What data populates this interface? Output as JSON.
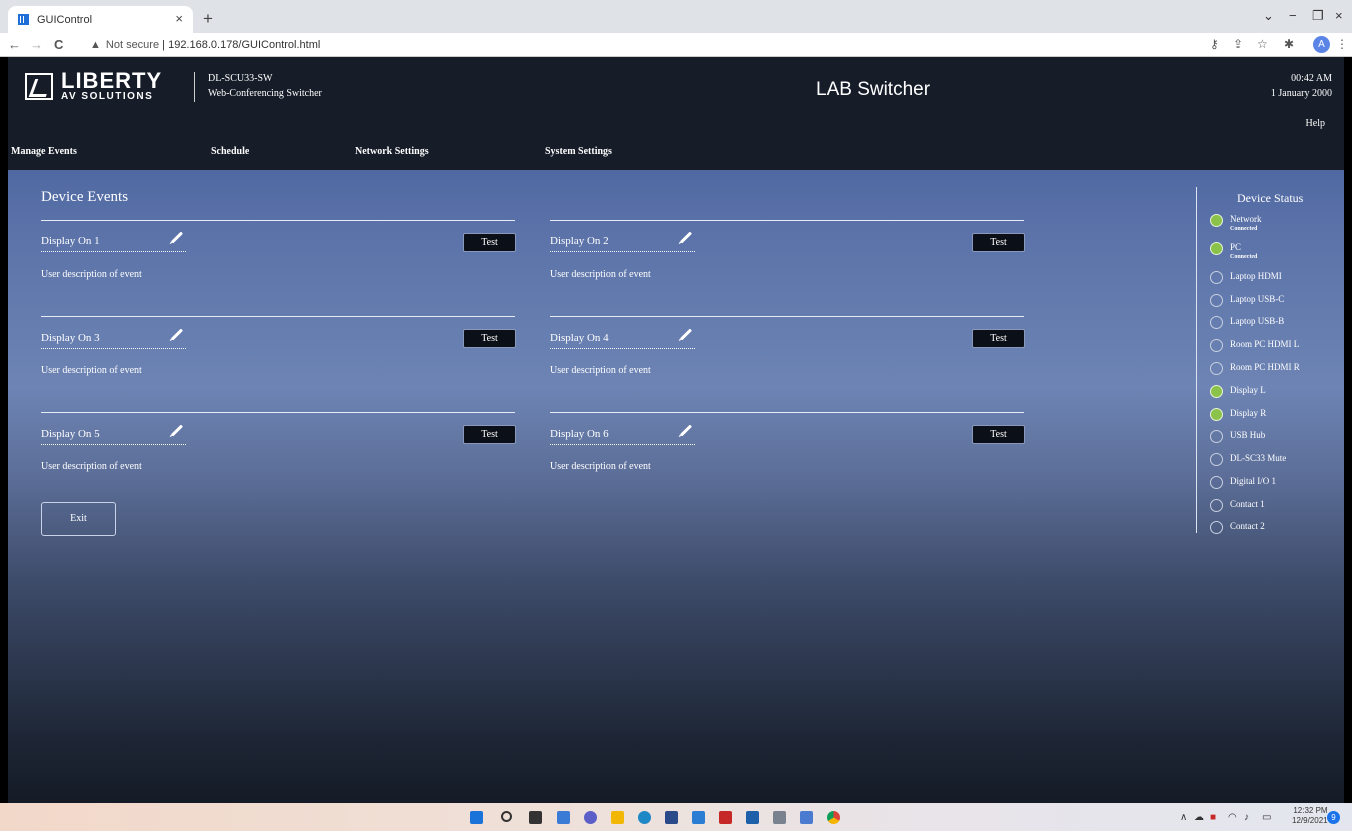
{
  "browser": {
    "tab_title": "GUIControl",
    "tab_close": "×",
    "new_tab": "+",
    "not_secure": "Not secure",
    "url": "192.168.0.178/GUIControl.html",
    "back": "←",
    "forward": "→",
    "reload": "C",
    "minimize": "−",
    "maximize": "❐",
    "close": "×",
    "dropdown": "⌄",
    "profile_initial": "A"
  },
  "header": {
    "logo_main": "LIBERTY",
    "logo_sub": "AV SOLUTIONS",
    "model": "DL-SCU33-SW",
    "model_desc": "Web-Conferencing Switcher",
    "app_title": "LAB Switcher",
    "time": "00:42 AM",
    "date": "1 January 2000",
    "help": "Help"
  },
  "menu": [
    "Manage Events",
    "Schedule",
    "Network Settings",
    "System Settings"
  ],
  "main": {
    "section_title": "Device Events",
    "test_label": "Test",
    "exit_label": "Exit",
    "events": [
      {
        "name": "Display On 1",
        "desc": "User description of event"
      },
      {
        "name": "Display On 2",
        "desc": "User description of event"
      },
      {
        "name": "Display On 3",
        "desc": "User description of event"
      },
      {
        "name": "Display On 4",
        "desc": "User description of event"
      },
      {
        "name": "Display On 5",
        "desc": "User description of event"
      },
      {
        "name": "Display On 6",
        "desc": "User description of event"
      }
    ]
  },
  "status": {
    "title": "Device Status",
    "items": [
      {
        "label": "Network",
        "sub": "Connected",
        "on": true
      },
      {
        "label": "PC",
        "sub": "Connected",
        "on": true
      },
      {
        "label": "Laptop HDMI",
        "sub": "",
        "on": false
      },
      {
        "label": "Laptop USB-C",
        "sub": "",
        "on": false
      },
      {
        "label": "Laptop USB-B",
        "sub": "",
        "on": false
      },
      {
        "label": "Room PC HDMI L",
        "sub": "",
        "on": false
      },
      {
        "label": "Room PC HDMI R",
        "sub": "",
        "on": false
      },
      {
        "label": "Display L",
        "sub": "",
        "on": true
      },
      {
        "label": "Display R",
        "sub": "",
        "on": true
      },
      {
        "label": "USB Hub",
        "sub": "",
        "on": false
      },
      {
        "label": "DL-SC33 Mute",
        "sub": "",
        "on": false
      },
      {
        "label": "Digital I/O 1",
        "sub": "",
        "on": false
      },
      {
        "label": "Contact 1",
        "sub": "",
        "on": false
      },
      {
        "label": "Contact 2",
        "sub": "",
        "on": false
      }
    ]
  },
  "taskbar": {
    "time": "12:32 PM",
    "date": "12/9/2021",
    "notifications": "9",
    "tray_icons": [
      "chevron-up-icon",
      "cloud-icon",
      "app-icon",
      "wifi-icon",
      "volume-icon",
      "battery-icon"
    ]
  }
}
